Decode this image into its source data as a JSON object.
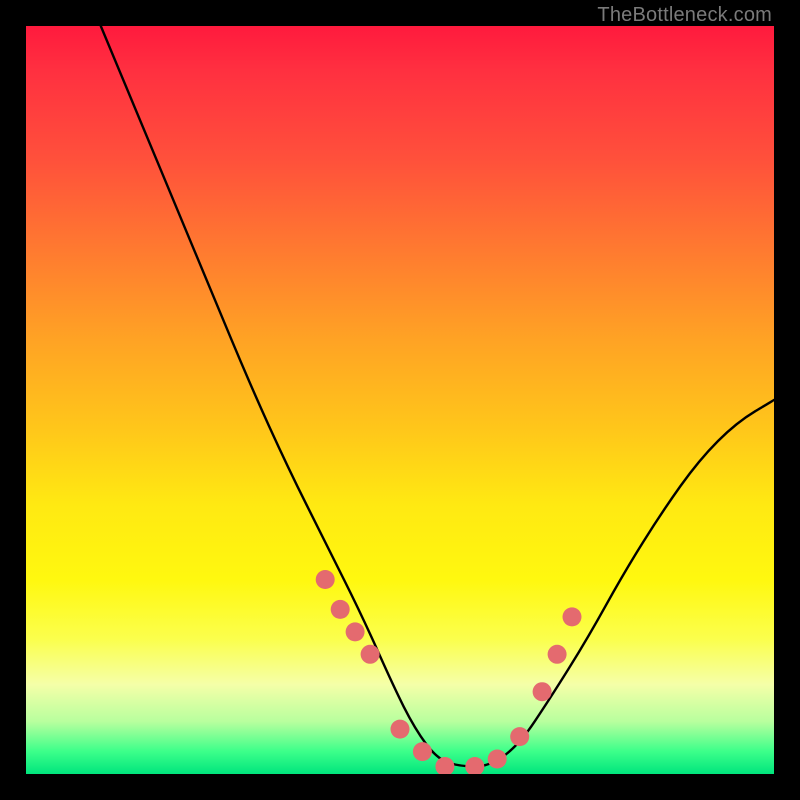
{
  "watermark": "TheBottleneck.com",
  "colors": {
    "curve": "#000000",
    "dot_fill": "#e46a6f",
    "dot_stroke": "#c94c52"
  },
  "chart_data": {
    "type": "line",
    "title": "",
    "xlabel": "",
    "ylabel": "",
    "xlim": [
      0,
      100
    ],
    "ylim": [
      0,
      100
    ],
    "grid": false,
    "legend": false,
    "notes": "V-shaped bottleneck curve on a vertical red→green gradient. x≈relative component index (arbitrary units). y≈bottleneck percentage (0 at bottom = no bottleneck). Values are estimated from the image since no axis ticks are present.",
    "series": [
      {
        "name": "bottleneck_curve",
        "x": [
          10,
          15,
          20,
          25,
          30,
          35,
          40,
          45,
          49,
          52,
          55,
          58,
          62,
          66,
          70,
          75,
          80,
          85,
          90,
          95,
          100
        ],
        "y": [
          100,
          88,
          76,
          64,
          52,
          41,
          31,
          21,
          12,
          6,
          2,
          1,
          1,
          4,
          10,
          18,
          27,
          35,
          42,
          47,
          50
        ]
      }
    ],
    "highlight_points": {
      "name": "markers",
      "x": [
        40,
        42,
        44,
        46,
        50,
        53,
        56,
        60,
        63,
        66,
        69,
        71,
        73
      ],
      "y": [
        26,
        22,
        19,
        16,
        6,
        3,
        1,
        1,
        2,
        5,
        11,
        16,
        21
      ]
    }
  }
}
